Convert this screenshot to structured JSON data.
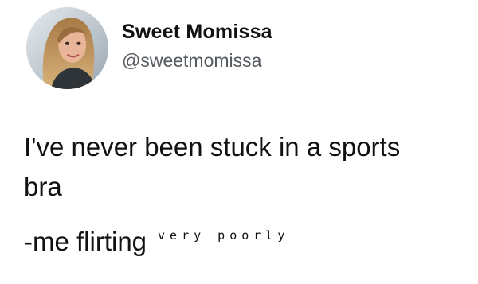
{
  "author": {
    "display_name": "Sweet Momissa",
    "handle": "@sweetmomissa"
  },
  "avatar_icon": "profile-photo",
  "tweet": {
    "line1": "I've never been stuck in a sports",
    "line2": "bra",
    "line3_main": "-me flirting",
    "line3_small": "very poorly"
  }
}
